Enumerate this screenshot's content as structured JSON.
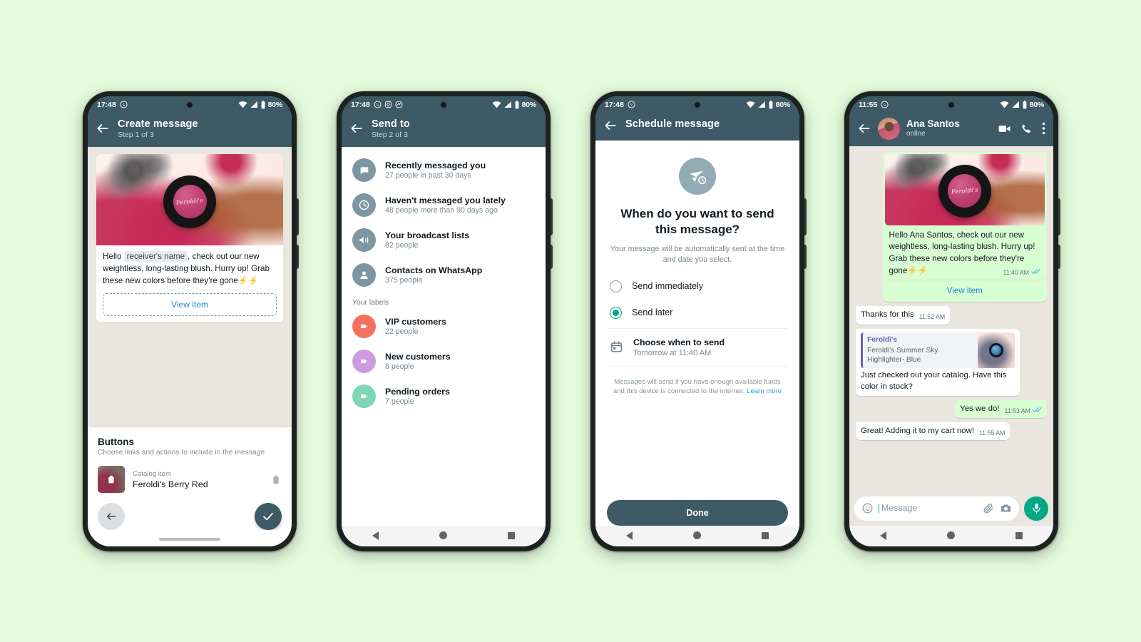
{
  "page": {
    "background_color": "#e4fbdc",
    "header_color": "#3d5a66",
    "accent_green": "#00a884",
    "link_blue": "#1e86d4"
  },
  "phones": [
    {
      "id": "create-message",
      "status": {
        "time": "17:48",
        "battery": "80%",
        "notifications": [
          "whatsapp-icon"
        ]
      },
      "appbar": {
        "title": "Create message",
        "subtitle": "Step 1 of 3",
        "back": "back-arrow-icon"
      },
      "message": {
        "text_before": "Hello",
        "placeholder_chip": "receiver's name",
        "text_after": ", check out our new weightless, long-lasting blush. Hurry up! Grab these new colors before they're gone",
        "emoji": "⚡⚡",
        "product_label": "Feroldi's",
        "view_item": "View item"
      },
      "buttons_sheet": {
        "title": "Buttons",
        "subtitle": "Choose links and actions to include in the message",
        "item_kind": "Catalog item",
        "item_name": "Feroldi's Berry Red",
        "delete": "trash-icon",
        "back_fab": "back-arrow-icon",
        "confirm_fab": "checkmark-icon"
      }
    },
    {
      "id": "send-to",
      "status": {
        "time": "17:48",
        "battery": "80%",
        "notifications": [
          "whatsapp-icon",
          "instagram-icon",
          "messenger-icon"
        ]
      },
      "appbar": {
        "title": "Send to",
        "subtitle": "Step 2  of 3",
        "back": "back-arrow-icon"
      },
      "audiences": [
        {
          "icon": "chat-bubble-icon",
          "title": "Recently messaged you",
          "subtitle": "27 people in past 30 days"
        },
        {
          "icon": "clock-icon",
          "title": "Haven't messaged you lately",
          "subtitle": "48 people more than 90 days ago"
        },
        {
          "icon": "megaphone-icon",
          "title": "Your broadcast lists",
          "subtitle": "82 people"
        },
        {
          "icon": "person-icon",
          "title": "Contacts on WhatsApp",
          "subtitle": "375 people"
        }
      ],
      "labels_heading": "Your labels",
      "labels": [
        {
          "title": "VIP customers",
          "subtitle": "22 people",
          "color": "#f4715f"
        },
        {
          "title": "New customers",
          "subtitle": "8 people",
          "color": "#cd9ce0"
        },
        {
          "title": "Pending orders",
          "subtitle": "7 people",
          "color": "#7ed7b4"
        }
      ]
    },
    {
      "id": "schedule-message",
      "status": {
        "time": "17:48",
        "battery": "80%",
        "notifications": [
          "whatsapp-icon"
        ]
      },
      "appbar": {
        "title": "Schedule message",
        "back": "back-arrow-icon"
      },
      "hero_icon": "send-clock-icon",
      "heading": "When do you want to send this message?",
      "description": "Your message will be automatically sent at the time and date you select.",
      "options": [
        {
          "label": "Send immediately",
          "selected": false
        },
        {
          "label": "Send later",
          "selected": true
        }
      ],
      "choose": {
        "icon": "calendar-icon",
        "title": "Choose when to send",
        "value": "Tomorrow at 11:40 AM"
      },
      "footnote": "Messages will send if you have enough available funds and this device is connected to the internet.",
      "footnote_link": "Learn more",
      "done_label": "Done"
    },
    {
      "id": "chat",
      "status": {
        "time": "11:55",
        "battery": "80%",
        "notifications": [
          "whatsapp-icon"
        ]
      },
      "appbar": {
        "contact": "Ana Santos",
        "presence": "online",
        "back": "back-arrow-icon",
        "actions": [
          "video-call-icon",
          "voice-call-icon",
          "overflow-menu-icon"
        ]
      },
      "messages": [
        {
          "type": "product-card",
          "direction": "out",
          "product_label": "Feroldi's",
          "text": "Hello Ana Santos, check out our new weightless, long-lasting blush. Hurry up! Grab these new colors before they're gone",
          "emoji": "⚡⚡",
          "time": "11:40 AM",
          "status_icon": "read-receipt-icon",
          "view_item": "View item"
        },
        {
          "type": "text",
          "direction": "in",
          "text": "Thanks for this",
          "time": "11:52 AM"
        },
        {
          "type": "quoted-text",
          "direction": "in",
          "quote_name": "Feroldi's",
          "quote_desc": "Feroldi's Summer Sky Highlighter- Blue",
          "text": "Just checked out your catalog. Have this color in stock?",
          "time": ""
        },
        {
          "type": "text",
          "direction": "out",
          "text": "Yes we do!",
          "time": "11:53 AM",
          "status_icon": "read-receipt-icon"
        },
        {
          "type": "text",
          "direction": "in",
          "text": "Great! Adding it to my cart now!",
          "time": "11:55 AM"
        }
      ],
      "composer": {
        "emoji_icon": "emoji-icon",
        "placeholder": "Message",
        "attach_icon": "paperclip-icon",
        "camera_icon": "camera-icon",
        "mic_icon": "microphone-icon"
      }
    }
  ],
  "navbar": {
    "back": "nav-back-icon",
    "home": "nav-home-icon",
    "recents": "nav-recents-icon"
  }
}
